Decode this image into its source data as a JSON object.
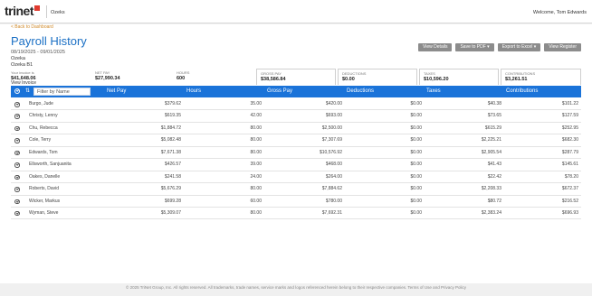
{
  "brand": {
    "logo": "trinet",
    "company": "Ozeks",
    "welcome": "Welcome, Tom Edwards"
  },
  "page": {
    "back_link": "< Back to Dashboard",
    "title": "Payroll History",
    "date_range": "08/19/2025 - 09/01/2025",
    "company_line1": "Ozeka",
    "company_line2": "Ozeka B1",
    "view_invoice": "View Invoice"
  },
  "actions": {
    "view_details": "View Details",
    "save_pdf": "Save to PDF ▾",
    "export_excel": "Export to Excel ▾",
    "view_register": "View Register"
  },
  "summary": {
    "invoice_label": "Your invoice is",
    "invoice_value": "$41,648.06",
    "net_pay_label": "NET PAY",
    "net_pay_value": "$27,990.34",
    "hours_label": "HOURS",
    "hours_value": "600",
    "gross_pay_label": "GROSS PAY",
    "gross_pay_value": "$38,586.84",
    "deductions_label": "DEDUCTIONS",
    "deductions_value": "$0.00",
    "taxes_label": "TAXES",
    "taxes_value": "$10,596.20",
    "contributions_label": "CONTRIBUTIONS",
    "contributions_value": "$3,261.51"
  },
  "table": {
    "filter_placeholder": "Filter by Name",
    "headers": {
      "net_pay": "Net Pay",
      "hours": "Hours",
      "gross_pay": "Gross Pay",
      "deductions": "Deductions",
      "taxes": "Taxes",
      "contributions": "Contributions"
    },
    "rows": [
      {
        "name": "Burgo, Jude",
        "net": "$379.62",
        "hours": "35.00",
        "gross": "$420.00",
        "ded": "$0.00",
        "tax": "$40.38",
        "contrib": "$101.22"
      },
      {
        "name": "Christy, Lenny",
        "net": "$619.35",
        "hours": "42.00",
        "gross": "$693.00",
        "ded": "$0.00",
        "tax": "$73.65",
        "contrib": "$127.59"
      },
      {
        "name": "Chu, Rebecca",
        "net": "$1,884.72",
        "hours": "80.00",
        "gross": "$2,500.00",
        "ded": "$0.00",
        "tax": "$615.29",
        "contrib": "$252.95"
      },
      {
        "name": "Cole, Terry",
        "net": "$5,082.48",
        "hours": "80.00",
        "gross": "$7,307.69",
        "ded": "$0.00",
        "tax": "$2,225.21",
        "contrib": "$682.30"
      },
      {
        "name": "Edwards, Tom",
        "net": "$7,671.38",
        "hours": "80.00",
        "gross": "$10,576.92",
        "ded": "$0.00",
        "tax": "$2,905.54",
        "contrib": "$287.79"
      },
      {
        "name": "Ellsworth, Sanjuanita",
        "net": "$426.57",
        "hours": "39.00",
        "gross": "$468.00",
        "ded": "$0.00",
        "tax": "$41.43",
        "contrib": "$145.61"
      },
      {
        "name": "Oakes, Danelle",
        "net": "$241.58",
        "hours": "24.00",
        "gross": "$264.00",
        "ded": "$0.00",
        "tax": "$22.42",
        "contrib": "$78.20"
      },
      {
        "name": "Roberts, David",
        "net": "$5,676.29",
        "hours": "80.00",
        "gross": "$7,884.62",
        "ded": "$0.00",
        "tax": "$2,208.33",
        "contrib": "$672.37"
      },
      {
        "name": "Wicker, Markus",
        "net": "$699.28",
        "hours": "60.00",
        "gross": "$780.00",
        "ded": "$0.00",
        "tax": "$80.72",
        "contrib": "$216.52"
      },
      {
        "name": "Wyman, Steve",
        "net": "$5,309.07",
        "hours": "80.00",
        "gross": "$7,692.31",
        "ded": "$0.00",
        "tax": "$2,383.24",
        "contrib": "$696.93"
      }
    ]
  },
  "footer": "© 2025 TriNet Group, Inc. All rights reserved. All trademarks, trade names, service marks and logos referenced herein belong to their respective companies. Terms of Use and Privacy Policy"
}
